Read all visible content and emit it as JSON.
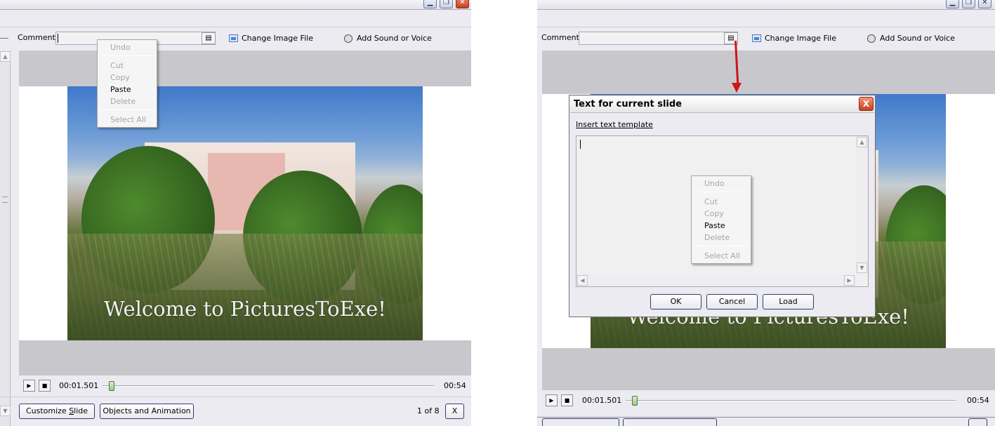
{
  "comment_label": "Comment",
  "change_image_label": "Change Image File",
  "add_sound_label": "Add Sound or Voice",
  "context_menu": {
    "undo": "Undo",
    "cut": "Cut",
    "copy": "Copy",
    "paste": "Paste",
    "delete": "Delete",
    "select_all": "Select All"
  },
  "slide_caption": "Welcome to PicturesToExe!",
  "player": {
    "current_time": "00:01.501",
    "total_time": "00:54",
    "progress_fraction": 0.02
  },
  "footer": {
    "customize_label_pre": "Customize ",
    "customize_label_mnemonic": "S",
    "customize_label_post": "lide",
    "objects_label": "Objects and Animation",
    "slide_counter": "1 of 8",
    "close_label": "X"
  },
  "dialog": {
    "title": "Text for current slide",
    "insert_template_link": "Insert text template",
    "ok_label": "OK",
    "cancel_label": "Cancel",
    "load_label": "Load",
    "close_label": "X"
  },
  "icons": {
    "comment_button": "document-icon",
    "change_image": "image-icon",
    "add_sound": "sound-icon"
  },
  "colors": {
    "arrow": "#d11414",
    "button_border": "#2f3e72"
  }
}
